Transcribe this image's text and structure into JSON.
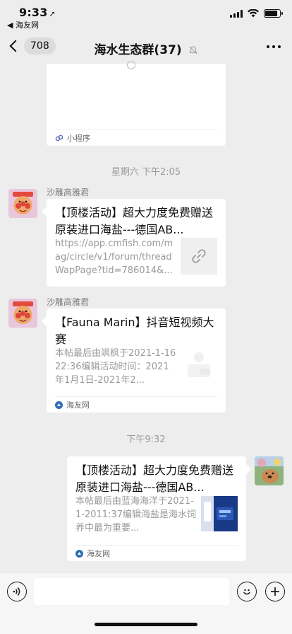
{
  "status_bar": {
    "time": "9:33",
    "back_app": "◀ 海友网"
  },
  "nav": {
    "back_badge": "708",
    "title": "海水生态群(37)"
  },
  "messages": [
    {
      "type": "mini-program-card",
      "footer_label": "小程序"
    },
    {
      "type": "timestamp",
      "text": "星期六 下午2:05"
    },
    {
      "type": "link-card",
      "sender": "沙雕高雅君",
      "title": "【顶楼活动】超大力度免费赠送原装进口海盐---德国AB...",
      "desc": "https://app.cmfish.com/mag/circle/v1/forum/threadWapPage?tid=786014&..."
    },
    {
      "type": "link-card",
      "sender": "沙雕高雅君",
      "title": "【Fauna Marin】抖音短视频大赛",
      "desc": "本帖最后由飒枫于2021-1-1622:36编辑活动时间：2021年1月1日-2021年2...",
      "footer_label": "海友网"
    },
    {
      "type": "timestamp",
      "text": "下午9:32"
    },
    {
      "type": "link-card-self",
      "title": "【顶楼活动】超大力度免费赠送原装进口海盐---德国AB...",
      "desc": "本帖最后由蓝海海洋于2021-1-2011:37编辑海盐是海水饲养中最为重要...",
      "footer_label": "海友网"
    }
  ]
}
